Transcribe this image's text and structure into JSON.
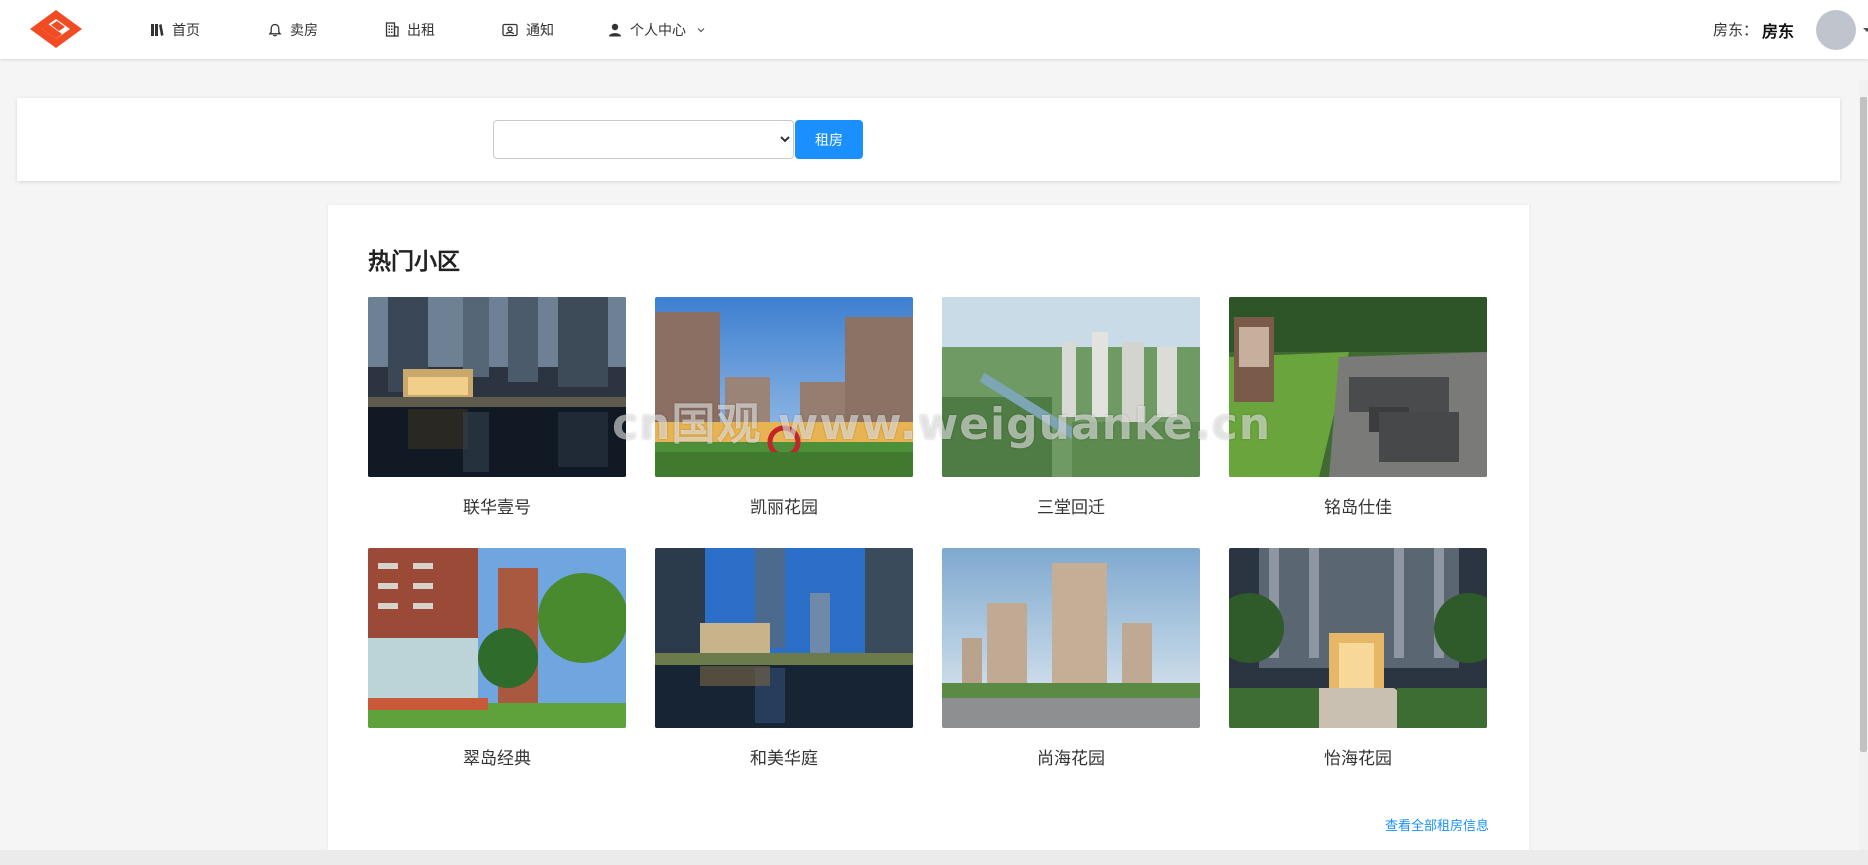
{
  "nav": {
    "items": [
      {
        "label": "首页",
        "icon": "book-icon"
      },
      {
        "label": "卖房",
        "icon": "bell-icon"
      },
      {
        "label": "出租",
        "icon": "building-icon"
      },
      {
        "label": "通知",
        "icon": "id-card-icon"
      },
      {
        "label": "个人中心",
        "icon": "user-icon"
      }
    ],
    "role_label": "房东：",
    "role_value": "房东"
  },
  "search": {
    "select_value": "",
    "button_label": "租房"
  },
  "section": {
    "title": "热门小区",
    "communities": [
      {
        "name": "联华壹号"
      },
      {
        "name": "凯丽花园"
      },
      {
        "name": "三堂回迁"
      },
      {
        "name": "铭岛仕佳"
      },
      {
        "name": "翠岛经典"
      },
      {
        "name": "和美华庭"
      },
      {
        "name": "尚海花园"
      },
      {
        "name": "怡海花园"
      }
    ],
    "view_all_label": "查看全部租房信息"
  },
  "watermark": "cn国观  www.weiguanke.cn",
  "colors": {
    "accent": "#1a90ff",
    "logo": "#f04b23"
  }
}
